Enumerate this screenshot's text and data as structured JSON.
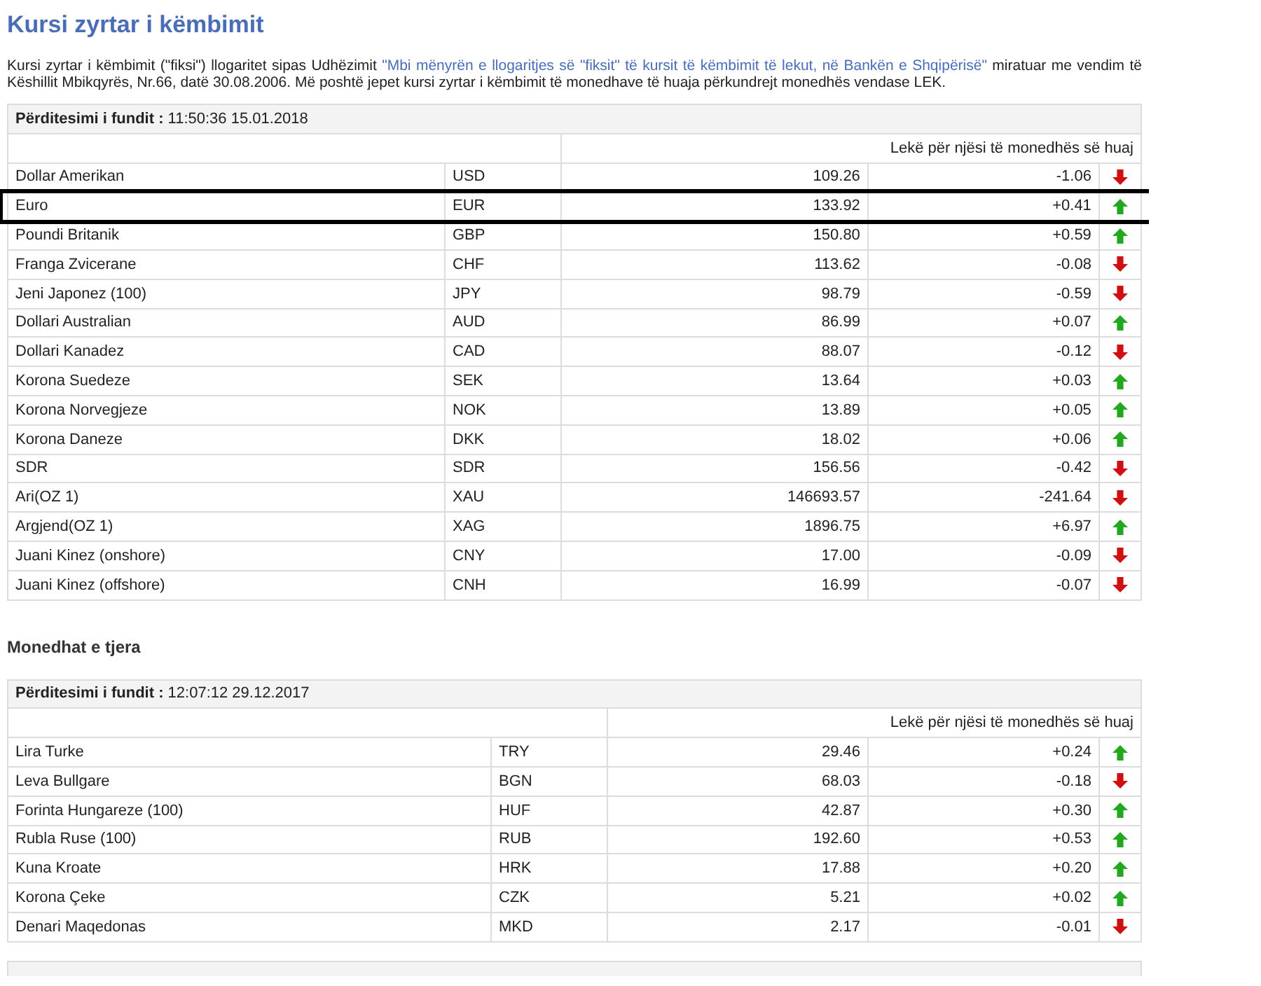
{
  "title": "Kursi zyrtar i këmbimit",
  "intro": {
    "before": "Kursi zyrtar i këmbimit (\"fiksi\") llogaritet sipas Udhëzimit ",
    "link": "\"Mbi mënyrën e llogaritjes së \"fiksit\" të kursit të këmbimit të lekut, në Bankën e Shqipërisë\"",
    "after": " miratuar me vendim të Këshillit Mbikqyrës, Nr.66, datë 30.08.2006. Më poshtë jepet kursi zyrtar i këmbimit të monedhave të huaja përkundrejt monedhës vendase LEK."
  },
  "tables": [
    {
      "update_label": "Përditesimi i fundit :",
      "update_time": "11:50:36 15.01.2018",
      "column_header": "Lekë për njësi të monedhës së huaj",
      "rows": [
        {
          "name": "Dollar Amerikan",
          "code": "USD",
          "rate": "109.26",
          "change": "-1.06",
          "rising": false,
          "highlighted": false
        },
        {
          "name": "Euro",
          "code": "EUR",
          "rate": "133.92",
          "change": "+0.41",
          "rising": true,
          "highlighted": true
        },
        {
          "name": "Poundi Britanik",
          "code": "GBP",
          "rate": "150.80",
          "change": "+0.59",
          "rising": true,
          "highlighted": false
        },
        {
          "name": "Franga Zvicerane",
          "code": "CHF",
          "rate": "113.62",
          "change": "-0.08",
          "rising": false,
          "highlighted": false
        },
        {
          "name": "Jeni Japonez (100)",
          "code": "JPY",
          "rate": "98.79",
          "change": "-0.59",
          "rising": false,
          "highlighted": false
        },
        {
          "name": "Dollari Australian",
          "code": "AUD",
          "rate": "86.99",
          "change": "+0.07",
          "rising": true,
          "highlighted": false
        },
        {
          "name": "Dollari Kanadez",
          "code": "CAD",
          "rate": "88.07",
          "change": "-0.12",
          "rising": false,
          "highlighted": false
        },
        {
          "name": "Korona Suedeze",
          "code": "SEK",
          "rate": "13.64",
          "change": "+0.03",
          "rising": true,
          "highlighted": false
        },
        {
          "name": "Korona Norvegjeze",
          "code": "NOK",
          "rate": "13.89",
          "change": "+0.05",
          "rising": true,
          "highlighted": false
        },
        {
          "name": "Korona Daneze",
          "code": "DKK",
          "rate": "18.02",
          "change": "+0.06",
          "rising": true,
          "highlighted": false
        },
        {
          "name": "SDR",
          "code": "SDR",
          "rate": "156.56",
          "change": "-0.42",
          "rising": false,
          "highlighted": false
        },
        {
          "name": "Ari(OZ 1)",
          "code": "XAU",
          "rate": "146693.57",
          "change": "-241.64",
          "rising": false,
          "highlighted": false
        },
        {
          "name": "Argjend(OZ 1)",
          "code": "XAG",
          "rate": "1896.75",
          "change": "+6.97",
          "rising": true,
          "highlighted": false
        },
        {
          "name": "Juani Kinez (onshore)",
          "code": "CNY",
          "rate": "17.00",
          "change": "-0.09",
          "rising": false,
          "highlighted": false
        },
        {
          "name": "Juani Kinez (offshore)",
          "code": "CNH",
          "rate": "16.99",
          "change": "-0.07",
          "rising": false,
          "highlighted": false
        }
      ]
    },
    {
      "heading": "Monedhat e tjera",
      "update_label": "Përditesimi i fundit :",
      "update_time": "12:07:12 29.12.2017",
      "column_header": "Lekë për njësi të monedhës së huaj",
      "rows": [
        {
          "name": "Lira Turke",
          "code": "TRY",
          "rate": "29.46",
          "change": "+0.24",
          "rising": true,
          "highlighted": false
        },
        {
          "name": "Leva Bullgare",
          "code": "BGN",
          "rate": "68.03",
          "change": "-0.18",
          "rising": false,
          "highlighted": false
        },
        {
          "name": "Forinta Hungareze (100)",
          "code": "HUF",
          "rate": "42.87",
          "change": "+0.30",
          "rising": true,
          "highlighted": false
        },
        {
          "name": "Rubla Ruse (100)",
          "code": "RUB",
          "rate": "192.60",
          "change": "+0.53",
          "rising": true,
          "highlighted": false
        },
        {
          "name": "Kuna Kroate",
          "code": "HRK",
          "rate": "17.88",
          "change": "+0.20",
          "rising": true,
          "highlighted": false
        },
        {
          "name": "Korona Çeke",
          "code": "CZK",
          "rate": "5.21",
          "change": "+0.02",
          "rising": true,
          "highlighted": false
        },
        {
          "name": "Denari Maqedonas",
          "code": "MKD",
          "rate": "2.17",
          "change": "-0.01",
          "rising": false,
          "highlighted": false
        }
      ]
    }
  ]
}
